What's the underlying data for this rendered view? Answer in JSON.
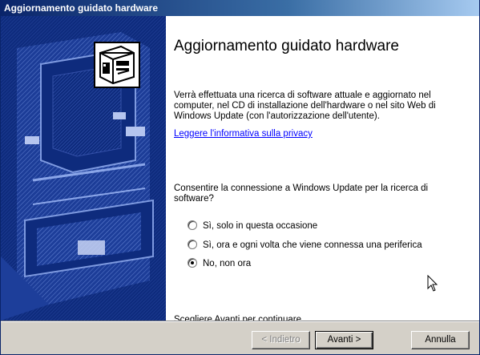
{
  "window": {
    "title": "Aggiornamento guidato hardware"
  },
  "content": {
    "heading": "Aggiornamento guidato hardware",
    "description": "Verrà effettuata una ricerca di software attuale e aggiornato nel computer, nel CD di installazione dell'hardware o nel sito Web di Windows Update (con l'autorizzazione dell'utente).",
    "privacy_link": "Leggere l'informativa sulla privacy",
    "prompt": "Consentire la connessione a Windows Update per la ricerca di software?",
    "options": [
      {
        "label": "Sì, solo in questa occasione",
        "selected": false
      },
      {
        "label": "Sì, ora e ogni volta che viene connessa una periferica",
        "selected": false
      },
      {
        "label": "No, non ora",
        "selected": true
      }
    ],
    "continue_text": "Scegliere Avanti per continuare."
  },
  "buttons": {
    "back": "< Indietro",
    "next": "Avanti >",
    "cancel": "Annulla"
  },
  "colors": {
    "title_active": "#0a246a",
    "side_panel": "#0e2b7d",
    "dialog_face": "#d4d0c8",
    "link": "#0000ff"
  },
  "icons": {
    "wizard_art": "hardware-wizard-banner",
    "hardware": "computer-hardware-icon",
    "cursor": "mouse-pointer"
  }
}
